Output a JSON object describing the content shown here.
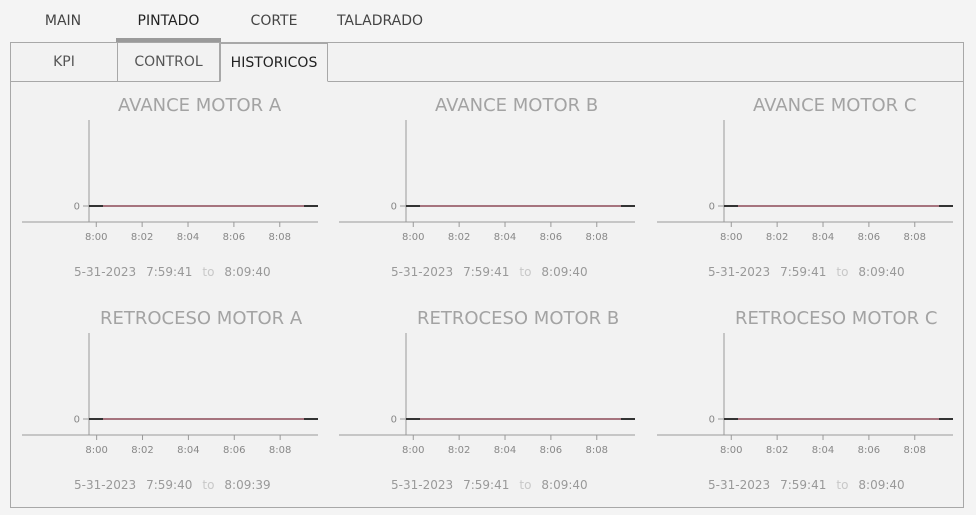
{
  "top_tabs": [
    {
      "label": "MAIN",
      "active": false
    },
    {
      "label": "PINTADO",
      "active": true
    },
    {
      "label": "CORTE",
      "active": false
    },
    {
      "label": "TALADRADO",
      "active": false
    }
  ],
  "sub_tabs": [
    {
      "label": "KPI",
      "active": false
    },
    {
      "label": "CONTROL",
      "active": false
    },
    {
      "label": "HISTORICOS",
      "active": true
    }
  ],
  "colors": {
    "line": "#7a2a3a",
    "axis": "#999999"
  },
  "charts": [
    {
      "title": "AVANCE MOTOR A",
      "date": "5-31-2023",
      "start": "7:59:41",
      "to": "to",
      "end": "8:09:40"
    },
    {
      "title": "AVANCE MOTOR B",
      "date": "5-31-2023",
      "start": "7:59:41",
      "to": "to",
      "end": "8:09:40"
    },
    {
      "title": "AVANCE MOTOR C",
      "date": "5-31-2023",
      "start": "7:59:41",
      "to": "to",
      "end": "8:09:40"
    },
    {
      "title": "RETROCESO MOTOR A",
      "date": "5-31-2023",
      "start": "7:59:40",
      "to": "to",
      "end": "8:09:39"
    },
    {
      "title": "RETROCESO MOTOR B",
      "date": "5-31-2023",
      "start": "7:59:41",
      "to": "to",
      "end": "8:09:40"
    },
    {
      "title": "RETROCESO MOTOR C",
      "date": "5-31-2023",
      "start": "7:59:41",
      "to": "to",
      "end": "8:09:40"
    }
  ],
  "chart_data": [
    {
      "type": "line",
      "title": "AVANCE MOTOR A",
      "x_ticks": [
        "8:00",
        "8:02",
        "8:04",
        "8:06",
        "8:08"
      ],
      "y_ticks": [
        "0"
      ],
      "series": [
        {
          "values": [
            0,
            0
          ]
        }
      ],
      "x": [
        "7:59:41",
        "8:09:40"
      ]
    },
    {
      "type": "line",
      "title": "AVANCE MOTOR B",
      "x_ticks": [
        "8:00",
        "8:02",
        "8:04",
        "8:06",
        "8:08"
      ],
      "y_ticks": [
        "0"
      ],
      "series": [
        {
          "values": [
            0,
            0
          ]
        }
      ],
      "x": [
        "7:59:41",
        "8:09:40"
      ]
    },
    {
      "type": "line",
      "title": "AVANCE MOTOR C",
      "x_ticks": [
        "8:00",
        "8:02",
        "8:04",
        "8:06",
        "8:08"
      ],
      "y_ticks": [
        "0"
      ],
      "series": [
        {
          "values": [
            0,
            0
          ]
        }
      ],
      "x": [
        "7:59:41",
        "8:09:40"
      ]
    },
    {
      "type": "line",
      "title": "RETROCESO MOTOR A",
      "x_ticks": [
        "8:00",
        "8:02",
        "8:04",
        "8:06",
        "8:08"
      ],
      "y_ticks": [
        "0"
      ],
      "series": [
        {
          "values": [
            0,
            0
          ]
        }
      ],
      "x": [
        "7:59:40",
        "8:09:39"
      ]
    },
    {
      "type": "line",
      "title": "RETROCESO MOTOR B",
      "x_ticks": [
        "8:00",
        "8:02",
        "8:04",
        "8:06",
        "8:08"
      ],
      "y_ticks": [
        "0"
      ],
      "series": [
        {
          "values": [
            0,
            0
          ]
        }
      ],
      "x": [
        "7:59:41",
        "8:09:40"
      ]
    },
    {
      "type": "line",
      "title": "RETROCESO MOTOR C",
      "x_ticks": [
        "8:00",
        "8:02",
        "8:04",
        "8:06",
        "8:08"
      ],
      "y_ticks": [
        "0"
      ],
      "series": [
        {
          "values": [
            0,
            0
          ]
        }
      ],
      "x": [
        "7:59:41",
        "8:09:40"
      ]
    }
  ]
}
